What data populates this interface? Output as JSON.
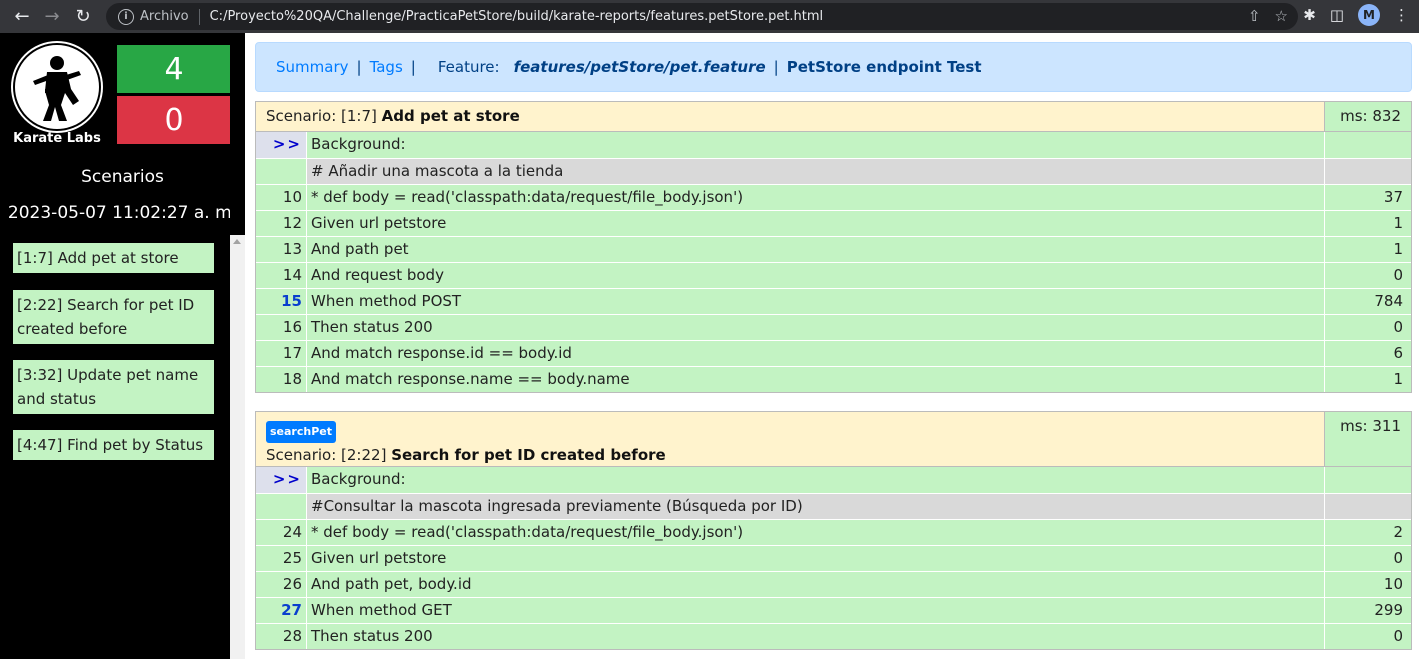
{
  "browser": {
    "scheme_label": "Archivo",
    "url": "C:/Proyecto%20QA/Challenge/PracticaPetStore/build/karate-reports/features.petStore.pet.html",
    "profile_initial": "M"
  },
  "sidebar": {
    "logo_text": "Karate Labs",
    "passed_count": "4",
    "failed_count": "0",
    "scenarios_title": "Scenarios",
    "date": "2023-05-07 11:02:27 a. m.",
    "links": [
      "[1:7] Add pet at store",
      "[2:22] Search for pet ID created before",
      "[3:32] Update pet name and status",
      "[4:47] Find pet by Status"
    ]
  },
  "nav": {
    "summary": "Summary",
    "tags": "Tags",
    "feature_label": "Feature:",
    "feature_path": "features/petStore/pet.feature",
    "feature_name": "PetStore endpoint Test"
  },
  "scenarios": [
    {
      "prefix": "Scenario: [1:7]",
      "title": "Add pet at store",
      "ms": "ms: 832",
      "rows": [
        {
          "num": ">>",
          "text": "Background:",
          "ms": ""
        },
        {
          "num": "",
          "text": "# Añadir una mascota a la tienda",
          "ms": ""
        },
        {
          "num": "10",
          "text": "* def body = read('classpath:data/request/file_body.json')",
          "ms": "37"
        },
        {
          "num": "12",
          "text": "Given url petstore",
          "ms": "1"
        },
        {
          "num": "13",
          "text": "And path pet",
          "ms": "1"
        },
        {
          "num": "14",
          "text": "And request body",
          "ms": "0"
        },
        {
          "num": "15",
          "text": "When method POST",
          "ms": "784"
        },
        {
          "num": "16",
          "text": "Then status 200",
          "ms": "0"
        },
        {
          "num": "17",
          "text": "And match response.id == body.id",
          "ms": "6"
        },
        {
          "num": "18",
          "text": "And match response.name == body.name",
          "ms": "1"
        }
      ]
    },
    {
      "tag": "searchPet",
      "prefix": "Scenario: [2:22]",
      "title": "Search for pet ID created before",
      "ms": "ms: 311",
      "rows": [
        {
          "num": ">>",
          "text": "Background:",
          "ms": ""
        },
        {
          "num": "",
          "text": "#Consultar la mascota ingresada previamente (Búsqueda por ID)",
          "ms": ""
        },
        {
          "num": "24",
          "text": "* def body = read('classpath:data/request/file_body.json')",
          "ms": "2"
        },
        {
          "num": "25",
          "text": "Given url petstore",
          "ms": "0"
        },
        {
          "num": "26",
          "text": "And path pet, body.id",
          "ms": "10"
        },
        {
          "num": "27",
          "text": "When method GET",
          "ms": "299"
        },
        {
          "num": "28",
          "text": "Then status 200",
          "ms": "0"
        }
      ]
    }
  ]
}
